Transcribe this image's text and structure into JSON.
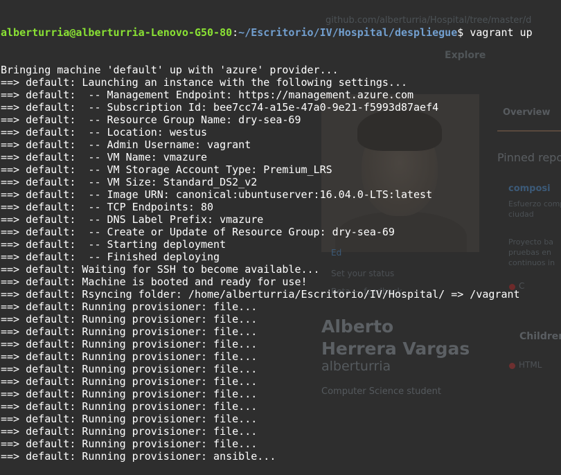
{
  "prompt": {
    "user_host": "alberturria@alberturria-Lenovo-G50-80",
    "separator": ":",
    "path": "~/Escritorio/IV/Hospital/despliegue",
    "symbol": "$ ",
    "command": "vagrant up"
  },
  "output_lines": [
    "Bringing machine 'default' up with 'azure' provider...",
    "==> default: Launching an instance with the following settings...",
    "==> default:  -- Management Endpoint: https://management.azure.com",
    "==> default:  -- Subscription Id: bee7cc74-a15e-47a0-9e21-f5993d87aef4",
    "==> default:  -- Resource Group Name: dry-sea-69",
    "==> default:  -- Location: westus",
    "==> default:  -- Admin Username: vagrant",
    "==> default:  -- VM Name: vmazure",
    "==> default:  -- VM Storage Account Type: Premium_LRS",
    "==> default:  -- VM Size: Standard_DS2_v2",
    "==> default:  -- Image URN: canonical:ubuntuserver:16.04.0-LTS:latest",
    "==> default:  -- TCP Endpoints: 80",
    "==> default:  -- DNS Label Prefix: vmazure",
    "==> default:  -- Create or Update of Resource Group: dry-sea-69",
    "==> default:  -- Starting deployment",
    "==> default:  -- Finished deploying",
    "==> default: Waiting for SSH to become available...",
    "==> default: Machine is booted and ready for use!",
    "==> default: Rsyncing folder: /home/alberturria/Escritorio/IV/Hospital/ => /vagrant",
    "==> default: Running provisioner: file...",
    "==> default: Running provisioner: file...",
    "==> default: Running provisioner: file...",
    "==> default: Running provisioner: file...",
    "==> default: Running provisioner: file...",
    "==> default: Running provisioner: file...",
    "==> default: Running provisioner: file...",
    "==> default: Running provisioner: file...",
    "==> default: Running provisioner: file...",
    "==> default: Running provisioner: file...",
    "==> default: Running provisioner: file...",
    "==> default: Running provisioner: file...",
    "==> default: Running provisioner: ansible..."
  ],
  "background_page": {
    "url_fragment": "github.com/alberturria/Hospital/tree/master/d",
    "nav_explore": "Explore",
    "tab_overview": "Overview",
    "pinned_heading": "Pinned repos",
    "repo1_name": "composi",
    "repo1_desc": [
      "Esfuerzo comp",
      "ciudad"
    ],
    "repo2_desc": [
      "Proyecto ba",
      "pruebas en",
      "continuos in"
    ],
    "repo_lang": "C",
    "children_heading": "Children",
    "html_lang": "HTML",
    "avatar_edit": "Ed",
    "status_text": "Set your status",
    "feedback_text": "Beta — feedback",
    "profile_name": "Alberto Herrera Vargas",
    "profile_user": "alberturria",
    "profile_bio": "Computer Science student"
  },
  "colors": {
    "background": "#2e2e2e",
    "prompt_user": "#8ae234",
    "prompt_path": "#729fcf",
    "text": "#ffffff"
  }
}
